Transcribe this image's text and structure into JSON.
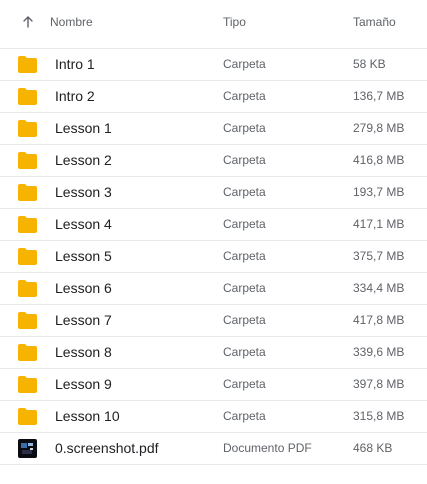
{
  "header": {
    "name_label": "Nombre",
    "type_label": "Tipo",
    "size_label": "Tamaño"
  },
  "colors": {
    "folder": "#f6b400",
    "pdf_thumb": "#0b0b12"
  },
  "rows": [
    {
      "name": "Intro 1",
      "type": "Carpeta",
      "size": "58 KB",
      "icon": "folder-icon"
    },
    {
      "name": "Intro 2",
      "type": "Carpeta",
      "size": "136,7 MB",
      "icon": "folder-icon"
    },
    {
      "name": "Lesson 1",
      "type": "Carpeta",
      "size": "279,8 MB",
      "icon": "folder-icon"
    },
    {
      "name": "Lesson 2",
      "type": "Carpeta",
      "size": "416,8 MB",
      "icon": "folder-icon"
    },
    {
      "name": "Lesson 3",
      "type": "Carpeta",
      "size": "193,7 MB",
      "icon": "folder-icon"
    },
    {
      "name": "Lesson 4",
      "type": "Carpeta",
      "size": "417,1 MB",
      "icon": "folder-icon"
    },
    {
      "name": "Lesson 5",
      "type": "Carpeta",
      "size": "375,7 MB",
      "icon": "folder-icon"
    },
    {
      "name": "Lesson 6",
      "type": "Carpeta",
      "size": "334,4 MB",
      "icon": "folder-icon"
    },
    {
      "name": "Lesson 7",
      "type": "Carpeta",
      "size": "417,8 MB",
      "icon": "folder-icon"
    },
    {
      "name": "Lesson 8",
      "type": "Carpeta",
      "size": "339,6 MB",
      "icon": "folder-icon"
    },
    {
      "name": "Lesson 9",
      "type": "Carpeta",
      "size": "397,8 MB",
      "icon": "folder-icon"
    },
    {
      "name": "Lesson 10",
      "type": "Carpeta",
      "size": "315,8 MB",
      "icon": "folder-icon"
    },
    {
      "name": "0.screenshot.pdf",
      "type": "Documento PDF",
      "size": "468 KB",
      "icon": "pdf-file-icon"
    }
  ]
}
